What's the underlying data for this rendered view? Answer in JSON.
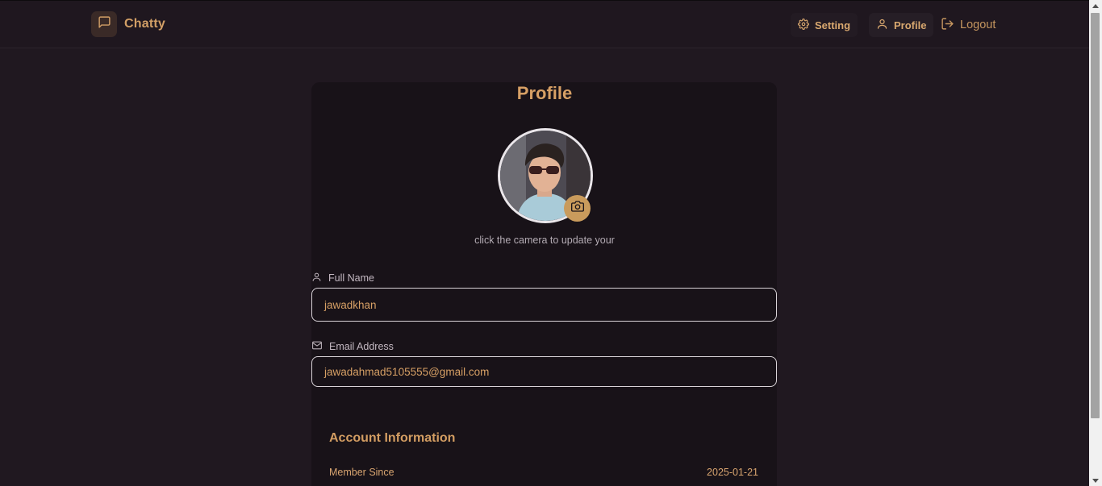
{
  "brand": {
    "name": "Chatty",
    "icon": "message-square-icon"
  },
  "nav": {
    "setting_label": "Setting",
    "profile_label": "Profile",
    "logout_label": "Logout"
  },
  "profile": {
    "title": "Profile",
    "avatar_hint": "click the camera to update your",
    "full_name_label": "Full Name",
    "full_name_value": "jawadkhan",
    "email_label": "Email Address",
    "email_value": "jawadahmad5105555@gmail.com"
  },
  "account": {
    "title": "Account Information",
    "member_since_label": "Member Since",
    "member_since_value": "2025-01-21"
  },
  "colors": {
    "background": "#201820",
    "card": "#181218",
    "accent": "#d29f66",
    "camera_button": "#c99b5c"
  }
}
